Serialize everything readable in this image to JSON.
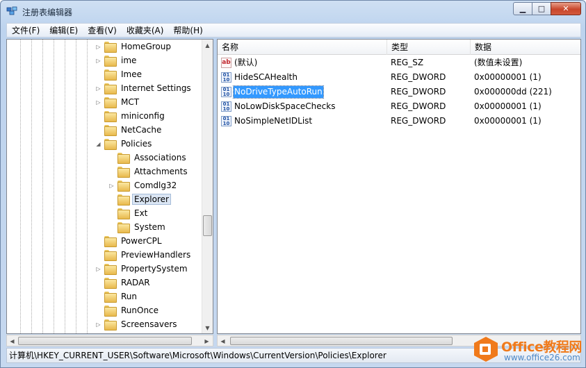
{
  "window": {
    "title": "注册表编辑器",
    "buttons": {
      "minimize": "▭",
      "maximize": "□",
      "close": "✕"
    }
  },
  "menu": [
    "文件(F)",
    "编辑(E)",
    "查看(V)",
    "收藏夹(A)",
    "帮助(H)"
  ],
  "tree": {
    "items": [
      {
        "label": "HomeGroup",
        "level": 1,
        "expandable": true
      },
      {
        "label": "ime",
        "level": 1,
        "expandable": true
      },
      {
        "label": "Imee",
        "level": 1,
        "expandable": false
      },
      {
        "label": "Internet Settings",
        "level": 1,
        "expandable": true
      },
      {
        "label": "MCT",
        "level": 1,
        "expandable": true
      },
      {
        "label": "miniconfig",
        "level": 1,
        "expandable": false
      },
      {
        "label": "NetCache",
        "level": 1,
        "expandable": false
      },
      {
        "label": "Policies",
        "level": 1,
        "expanded": true
      },
      {
        "label": "Associations",
        "level": 2,
        "expandable": false
      },
      {
        "label": "Attachments",
        "level": 2,
        "expandable": false
      },
      {
        "label": "Comdlg32",
        "level": 2,
        "expandable": true
      },
      {
        "label": "Explorer",
        "level": 2,
        "selected": true
      },
      {
        "label": "Ext",
        "level": 2,
        "expandable": false
      },
      {
        "label": "System",
        "level": 2,
        "expandable": false
      },
      {
        "label": "PowerCPL",
        "level": 1,
        "expandable": false
      },
      {
        "label": "PreviewHandlers",
        "level": 1,
        "expandable": false
      },
      {
        "label": "PropertySystem",
        "level": 1,
        "expandable": true
      },
      {
        "label": "RADAR",
        "level": 1,
        "expandable": false
      },
      {
        "label": "Run",
        "level": 1,
        "expandable": false
      },
      {
        "label": "RunOnce",
        "level": 1,
        "expandable": false
      },
      {
        "label": "Screensavers",
        "level": 1,
        "expandable": true
      }
    ]
  },
  "list": {
    "columns": [
      "名称",
      "类型",
      "数据"
    ],
    "rows": [
      {
        "icon": "ab",
        "name": "(默认)",
        "type": "REG_SZ",
        "data": "(数值未设置)"
      },
      {
        "icon": "bin",
        "name": "HideSCAHealth",
        "type": "REG_DWORD",
        "data": "0x00000001 (1)"
      },
      {
        "icon": "bin",
        "name": "NoDriveTypeAutoRun",
        "type": "REG_DWORD",
        "data": "0x000000dd (221)",
        "selected": true
      },
      {
        "icon": "bin",
        "name": "NoLowDiskSpaceChecks",
        "type": "REG_DWORD",
        "data": "0x00000001 (1)"
      },
      {
        "icon": "bin",
        "name": "NoSimpleNetIDList",
        "type": "REG_DWORD",
        "data": "0x00000001 (1)"
      }
    ]
  },
  "status": "计算机\\HKEY_CURRENT_USER\\Software\\Microsoft\\Windows\\CurrentVersion\\Policies\\Explorer",
  "watermark": {
    "title": "Office教程网",
    "url": "www.office26.com"
  }
}
